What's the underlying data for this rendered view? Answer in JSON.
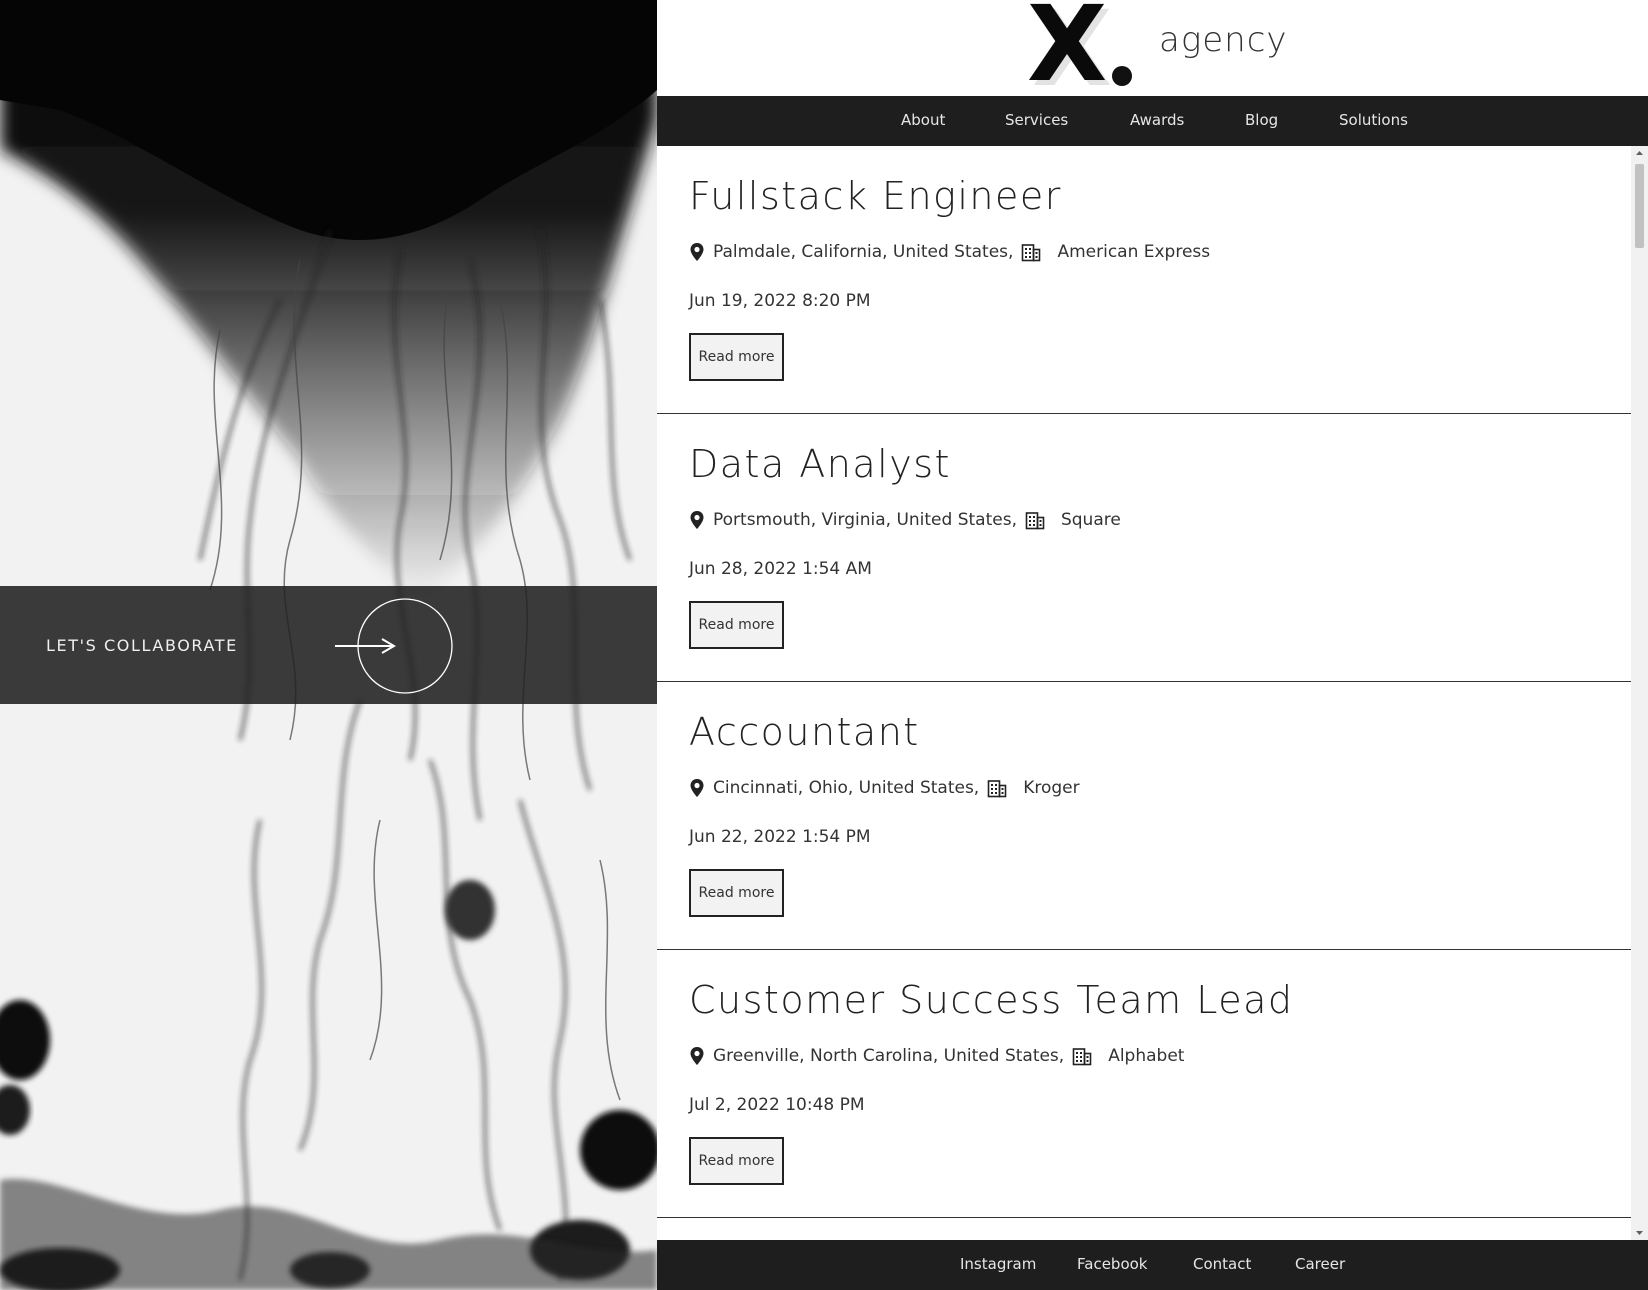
{
  "collab": {
    "label": "LET'S COLLABORATE"
  },
  "brand": {
    "mark": "X",
    "name": "agency"
  },
  "nav": [
    {
      "label": "About"
    },
    {
      "label": "Services"
    },
    {
      "label": "Awards"
    },
    {
      "label": "Blog"
    },
    {
      "label": "Solutions"
    }
  ],
  "jobs": [
    {
      "title": "Fullstack Engineer",
      "location": "Palmdale, California, United States,",
      "company": "American Express",
      "date": "Jun 19, 2022 8:20 PM",
      "button": "Read more"
    },
    {
      "title": "Data Analyst",
      "location": "Portsmouth, Virginia, United States,",
      "company": "Square",
      "date": "Jun 28, 2022 1:54 AM",
      "button": "Read more"
    },
    {
      "title": "Accountant",
      "location": "Cincinnati, Ohio, United States,",
      "company": "Kroger",
      "date": "Jun 22, 2022 1:54 PM",
      "button": "Read more"
    },
    {
      "title": "Customer Success Team Lead",
      "location": "Greenville, North Carolina, United States,",
      "company": "Alphabet",
      "date": "Jul 2, 2022 10:48 PM",
      "button": "Read more"
    }
  ],
  "footer": [
    {
      "label": "Instagram"
    },
    {
      "label": "Facebook"
    },
    {
      "label": "Contact"
    },
    {
      "label": "Career"
    }
  ],
  "colors": {
    "dark_bar": "#1e1e1e",
    "text": "#222222",
    "button_bg": "#f2f2f2"
  }
}
